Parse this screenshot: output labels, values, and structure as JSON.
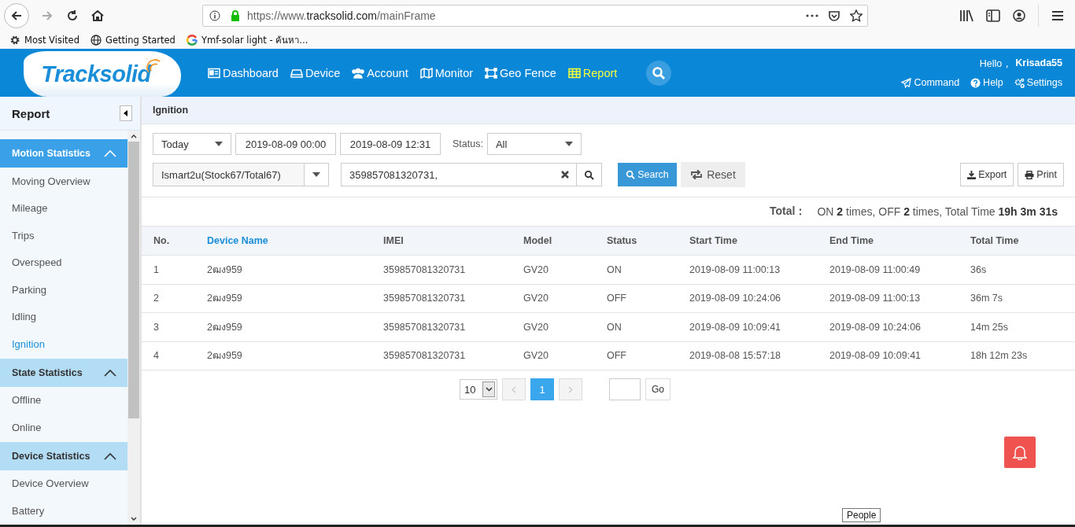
{
  "browser": {
    "url": {
      "scheme": "https://www.",
      "domain": "tracksolid.com",
      "path": "/mainFrame"
    },
    "bookmarks": [
      {
        "label": "Most Visited",
        "kind": "gear"
      },
      {
        "label": "Getting Started",
        "kind": "globe"
      },
      {
        "label": "Ymf-solar light - ค้นหา...",
        "kind": "google"
      }
    ]
  },
  "app": {
    "logo": "Tracksolid",
    "nav": [
      {
        "label": "Dashboard",
        "kind": "card",
        "selected": false
      },
      {
        "label": "Device",
        "kind": "drive",
        "selected": false
      },
      {
        "label": "Account",
        "kind": "users",
        "selected": false
      },
      {
        "label": "Monitor",
        "kind": "map",
        "selected": false
      },
      {
        "label": "Geo Fence",
        "kind": "fence",
        "selected": false
      },
      {
        "label": "Report",
        "kind": "table",
        "selected": true
      }
    ],
    "greeting": "Hello，",
    "user": "Krisada55",
    "links": [
      {
        "label": "Command",
        "kind": "send"
      },
      {
        "label": "Help",
        "kind": "help"
      },
      {
        "label": "Settings",
        "kind": "gears"
      }
    ]
  },
  "sidebar": {
    "title": "Report",
    "groups": [
      {
        "label": "Motion Statistics",
        "selected": true,
        "expanded": true,
        "items": [
          {
            "label": "Moving Overview",
            "selected": false
          },
          {
            "label": "Mileage",
            "selected": false
          },
          {
            "label": "Trips",
            "selected": false
          },
          {
            "label": "Overspeed",
            "selected": false
          },
          {
            "label": "Parking",
            "selected": false
          },
          {
            "label": "Idling",
            "selected": false
          },
          {
            "label": "Ignition",
            "selected": true
          }
        ]
      },
      {
        "label": "State Statistics",
        "selected": false,
        "expanded": true,
        "items": [
          {
            "label": "Offline",
            "selected": false
          },
          {
            "label": "Online",
            "selected": false
          }
        ]
      },
      {
        "label": "Device Statistics",
        "selected": false,
        "expanded": true,
        "items": [
          {
            "label": "Device Overview",
            "selected": false
          },
          {
            "label": "Battery",
            "selected": false
          }
        ]
      }
    ]
  },
  "page": {
    "title": "Ignition",
    "filters": {
      "period": "Today",
      "start": "2019-08-09 00:00",
      "end": "2019-08-09 12:31",
      "status_label": "Status:",
      "status": "All",
      "account": "Ismart2u(Stock67/Total67)",
      "imei": "359857081320731,",
      "search": "Search",
      "reset": "Reset",
      "export": "Export",
      "print": "Print"
    },
    "total_label": "Total：",
    "total_summary": "ON **2** times, OFF **2** times, Total Time **19h 3m 31s**",
    "table": {
      "columns": [
        {
          "label": "No.",
          "active": false
        },
        {
          "label": "Device Name",
          "active": true
        },
        {
          "label": "IMEI",
          "active": false
        },
        {
          "label": "Model",
          "active": false
        },
        {
          "label": "Status",
          "active": false
        },
        {
          "label": "Start Time",
          "active": false
        },
        {
          "label": "End Time",
          "active": false
        },
        {
          "label": "Total Time",
          "active": false
        }
      ],
      "rows": [
        [
          "1",
          "2ฒง959",
          "359857081320731",
          "GV20",
          "ON",
          "2019-08-09 11:00:13",
          "2019-08-09 11:00:49",
          "36s"
        ],
        [
          "2",
          "2ฒง959",
          "359857081320731",
          "GV20",
          "OFF",
          "2019-08-09 10:24:06",
          "2019-08-09 11:00:13",
          "36m 7s"
        ],
        [
          "3",
          "2ฒง959",
          "359857081320731",
          "GV20",
          "ON",
          "2019-08-09 10:09:41",
          "2019-08-09 10:24:06",
          "14m 25s"
        ],
        [
          "4",
          "2ฒง959",
          "359857081320731",
          "GV20",
          "OFF",
          "2019-08-08 15:57:18",
          "2019-08-09 10:09:41",
          "18h 12m 23s"
        ]
      ]
    },
    "pagination": {
      "page_size": "10",
      "pages": [
        {
          "label": "1",
          "selected": true
        }
      ],
      "go": "Go"
    }
  },
  "tooltip": "People"
}
